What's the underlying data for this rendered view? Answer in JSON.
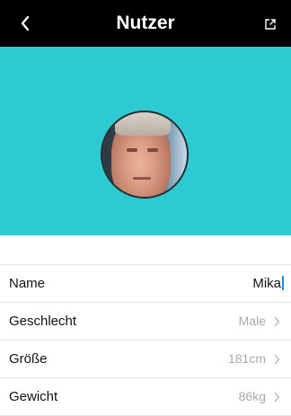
{
  "header": {
    "title": "Nutzer",
    "back_icon": "chevron-left-icon",
    "share_icon": "share-icon"
  },
  "hero": {
    "bg_color": "#2ecad2",
    "label": "Profilbild"
  },
  "profile": {
    "name": {
      "label": "Name",
      "value": "Mika"
    },
    "gender": {
      "label": "Geschlecht",
      "value": "Male"
    },
    "height": {
      "label": "Größe",
      "value": "181cm"
    },
    "weight": {
      "label": "Gewicht",
      "value": "86kg"
    }
  }
}
